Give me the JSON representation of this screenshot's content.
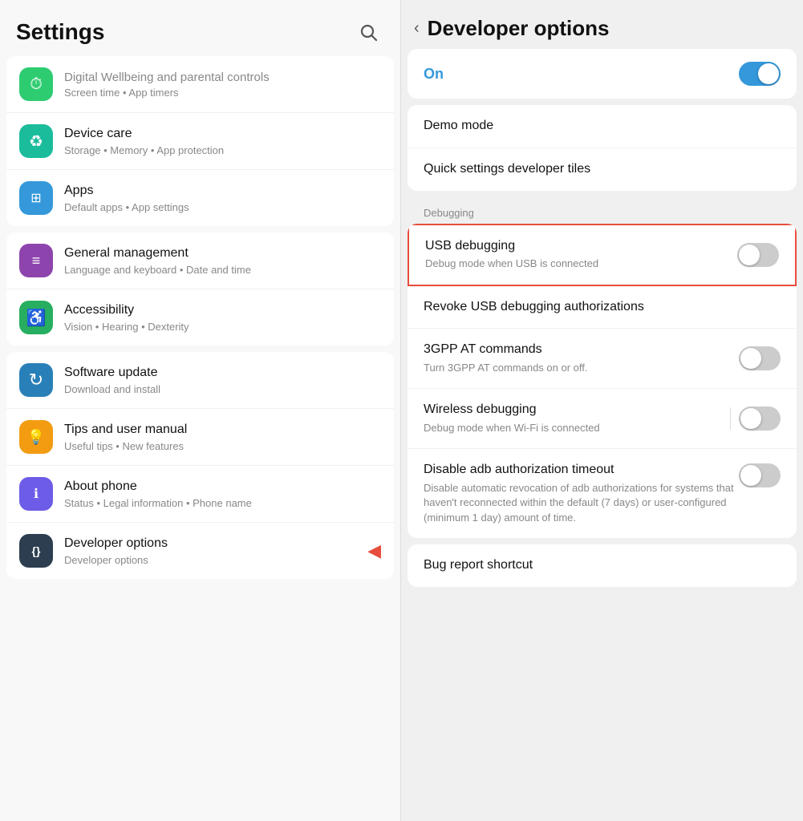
{
  "left": {
    "header": {
      "title": "Settings",
      "search_aria": "Search"
    },
    "groups": [
      {
        "id": "group1",
        "items": [
          {
            "id": "digital-wellbeing",
            "icon_color": "icon-green",
            "icon_symbol": "⏱",
            "title_faded": true,
            "title": "Digital Wellbeing and parental controls",
            "subtitle": "Screen time • App timers"
          },
          {
            "id": "device-care",
            "icon_color": "icon-teal",
            "icon_symbol": "♻",
            "title": "Device care",
            "subtitle": "Storage • Memory • App protection"
          },
          {
            "id": "apps",
            "icon_color": "icon-blue",
            "icon_symbol": "⊞",
            "title": "Apps",
            "subtitle": "Default apps • App settings"
          }
        ]
      },
      {
        "id": "group2",
        "items": [
          {
            "id": "general-management",
            "icon_color": "icon-purple",
            "icon_symbol": "≡",
            "title": "General management",
            "subtitle": "Language and keyboard • Date and time"
          },
          {
            "id": "accessibility",
            "icon_color": "icon-green2",
            "icon_symbol": "♿",
            "title": "Accessibility",
            "subtitle": "Vision • Hearing • Dexterity"
          }
        ]
      },
      {
        "id": "group3",
        "items": [
          {
            "id": "software-update",
            "icon_color": "icon-blue2",
            "icon_symbol": "↻",
            "title": "Software update",
            "subtitle": "Download and install"
          },
          {
            "id": "tips-manual",
            "icon_color": "icon-yellow",
            "icon_symbol": "💡",
            "title": "Tips and user manual",
            "subtitle": "Useful tips • New features"
          },
          {
            "id": "about-phone",
            "icon_color": "icon-purple2",
            "icon_symbol": "ℹ",
            "title": "About phone",
            "subtitle": "Status • Legal information • Phone name"
          },
          {
            "id": "developer-options",
            "icon_color": "icon-dark",
            "icon_symbol": "{}",
            "title": "Developer options",
            "subtitle": "Developer options",
            "has_arrow": true
          }
        ]
      }
    ]
  },
  "right": {
    "header": {
      "back_label": "‹",
      "title": "Developer options"
    },
    "on_section": {
      "label": "On",
      "toggle_state": "on"
    },
    "items": [
      {
        "id": "demo-mode",
        "title": "Demo mode",
        "subtitle": "",
        "has_toggle": false,
        "group": "top"
      },
      {
        "id": "quick-settings-tiles",
        "title": "Quick settings developer tiles",
        "subtitle": "",
        "has_toggle": false,
        "group": "top"
      }
    ],
    "debugging_section_label": "Debugging",
    "debugging_items": [
      {
        "id": "usb-debugging",
        "title": "USB debugging",
        "subtitle": "Debug mode when USB is connected",
        "has_toggle": true,
        "toggle_state": "off",
        "highlighted": true
      },
      {
        "id": "revoke-usb",
        "title": "Revoke USB debugging authorizations",
        "subtitle": "",
        "has_toggle": false,
        "highlighted": false
      },
      {
        "id": "3gpp-commands",
        "title": "3GPP AT commands",
        "subtitle": "Turn 3GPP AT commands on or off.",
        "has_toggle": true,
        "toggle_state": "off",
        "highlighted": false
      },
      {
        "id": "wireless-debugging",
        "title": "Wireless debugging",
        "subtitle": "Debug mode when Wi-Fi is connected",
        "has_toggle": true,
        "toggle_state": "off",
        "highlighted": false,
        "has_separator": true
      },
      {
        "id": "disable-adb-timeout",
        "title": "Disable adb authorization timeout",
        "subtitle": "Disable automatic revocation of adb authorizations for systems that haven't reconnected within the default (7 days) or user-configured (minimum 1 day) amount of time.",
        "has_toggle": true,
        "toggle_state": "off",
        "highlighted": false
      }
    ],
    "more_items": [
      {
        "id": "bug-report",
        "title": "Bug report shortcut",
        "subtitle": "",
        "has_toggle": false
      }
    ]
  }
}
